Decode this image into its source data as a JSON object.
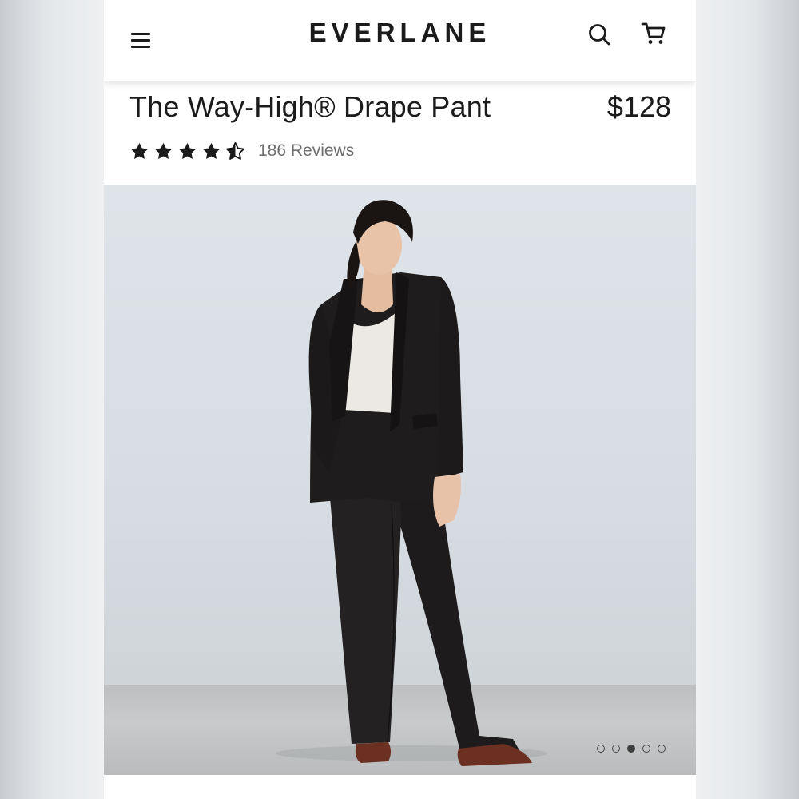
{
  "header": {
    "brand": "EVERLANE",
    "menu_icon": "hamburger-menu-icon",
    "search_icon": "search-icon",
    "cart_icon": "cart-icon"
  },
  "product": {
    "title": "The Way-High® Drape Pant",
    "price": "$128",
    "rating": 4.5,
    "rating_max": 5,
    "reviews_label": "186 Reviews"
  },
  "gallery": {
    "image_count": 5,
    "active_index": 2
  }
}
